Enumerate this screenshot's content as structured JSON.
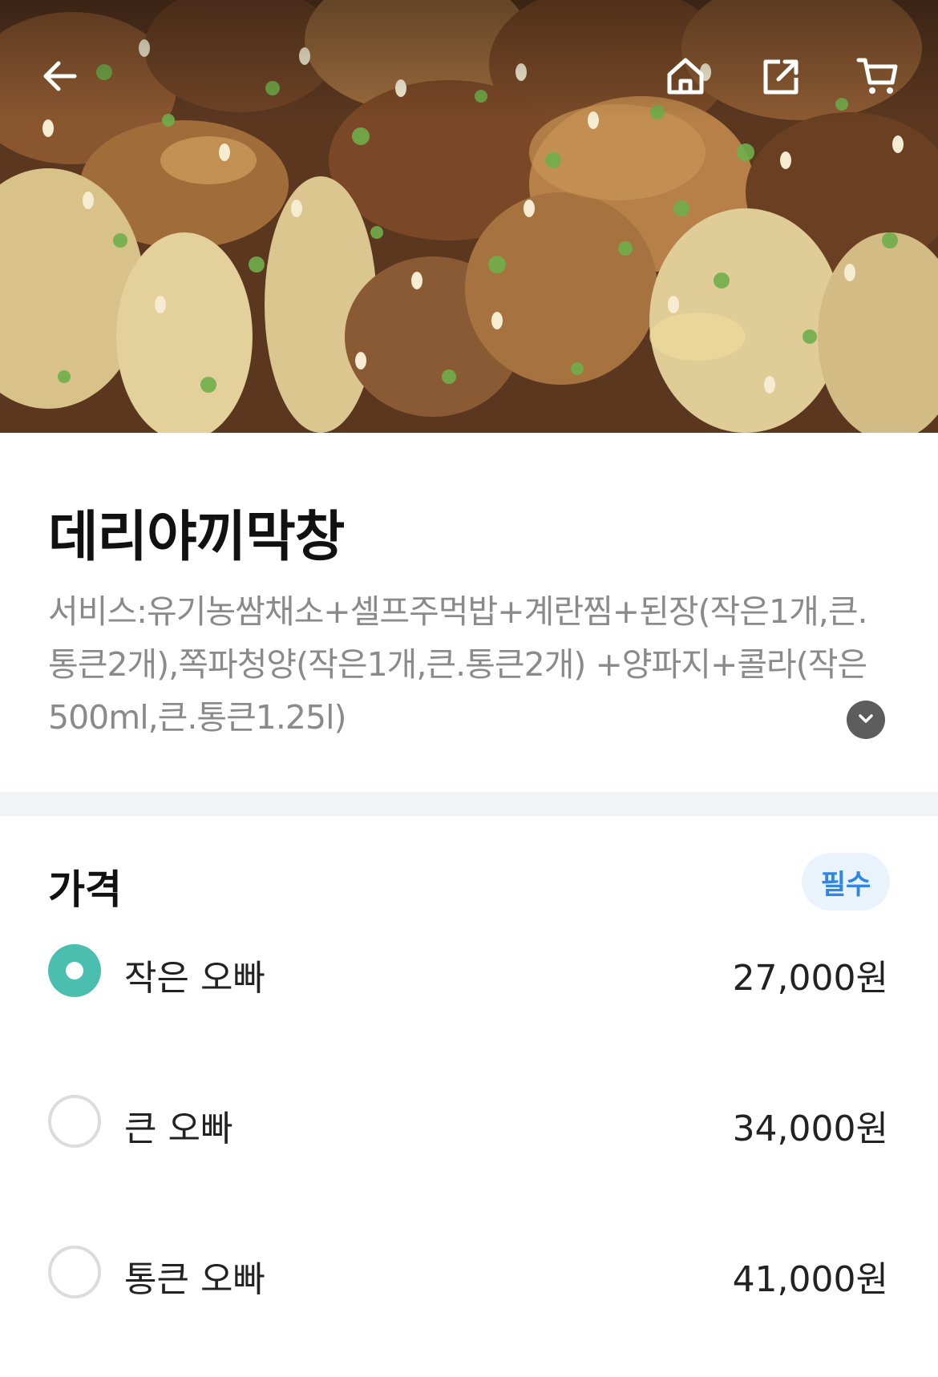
{
  "header": {
    "icons": [
      "back-arrow-icon",
      "home-icon",
      "share-icon",
      "cart-icon"
    ]
  },
  "product": {
    "name": "데리야끼막창",
    "description": "서비스:유기농쌈채소+셀프주먹밥+계란찜+된장(작은1개,큰.통큰2개),쪽파청양(작은1개,큰.통큰2개) +양파지+콜라(작은500ml,큰.통큰1.25l)"
  },
  "price_section": {
    "title": "가격",
    "badge": "필수",
    "options": [
      {
        "label": "작은 오빠",
        "price": "27,000원",
        "selected": true
      },
      {
        "label": "큰 오빠",
        "price": "34,000원",
        "selected": false
      },
      {
        "label": "통큰 오빠",
        "price": "41,000원",
        "selected": false
      }
    ]
  },
  "colors": {
    "accent": "#4bbfaf",
    "badge_text": "#2f86e8",
    "badge_bg": "#eaf3fc",
    "divider": "#f2f3f5"
  }
}
